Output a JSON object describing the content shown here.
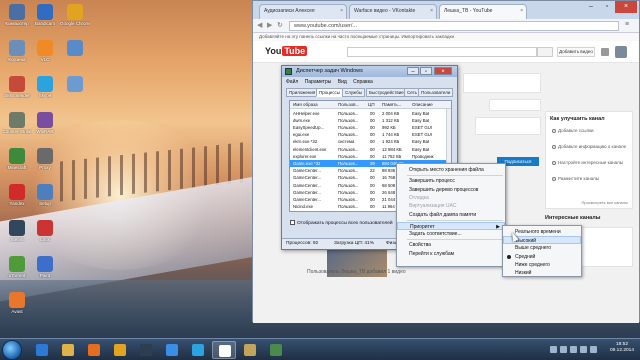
{
  "desktop": {
    "icons_left": [
      {
        "label": "Компьютер",
        "color": "#4a6fa5"
      },
      {
        "label": "Корзина",
        "color": "#6b8fb8"
      },
      {
        "label": "SMS Sender",
        "color": "#c64a3a"
      },
      {
        "label": "Counter-Strike",
        "color": "#6e7a6a"
      },
      {
        "label": "Minecraft",
        "color": "#3d8a3d"
      },
      {
        "label": "Yandex",
        "color": "#d12a2a"
      },
      {
        "label": "Steam",
        "color": "#33475c"
      },
      {
        "label": "uTorrent",
        "color": "#4f9b3a"
      },
      {
        "label": "Avast",
        "color": "#e8762b"
      }
    ],
    "icons_col2": [
      {
        "label": "Bandicam",
        "color": "#2f6cc2"
      },
      {
        "label": "VLC",
        "color": "#f08a24"
      },
      {
        "label": "Skype",
        "color": "#2aa3e0"
      },
      {
        "label": "WinRAR",
        "color": "#7a4da0"
      },
      {
        "label": "Proxy",
        "color": "#6a6a6a"
      },
      {
        "label": "Setup",
        "color": "#4d7fbf"
      },
      {
        "label": "Lock",
        "color": "#c33"
      },
      {
        "label": "Paint",
        "color": "#3d6ec9"
      }
    ],
    "icons_col3": [
      {
        "label": "Google Chrome",
        "color": "#e2a321"
      },
      {
        "label": "",
        "color": "#5a8ac8"
      },
      {
        "label": "",
        "color": "#6b9bd1"
      }
    ]
  },
  "chrome": {
    "tabs": [
      {
        "label": "Аудиозаписи Алексея",
        "active": false
      },
      {
        "label": "Warface видео - VKontakte",
        "active": false
      },
      {
        "label": "Лешка_ТВ - YouTube",
        "active": true
      }
    ],
    "url": "www.youtube.com/user/...",
    "infobar": "Добавляйте на эту панель ссылки на часто посещаемые страницы. Импортировать закладки",
    "yt_logo": "You",
    "yt_logo_tube": "Tube",
    "upload_label": "Добавить видео",
    "subscribe_label": "Подписаться",
    "right_panel": {
      "title": "Как улучшить канал",
      "items": [
        "Добавьте ссылки",
        "Добавьте информацию о канале",
        "Настройте интересные каналы",
        "Разместите каналы"
      ],
      "link": "Просмотреть все каналы"
    },
    "interesting_title": "Интересные каналы",
    "uploader": "Пользователь Лешка_ТВ добавил 1 видео"
  },
  "taskmgr": {
    "title": "Диспетчер задач Windows",
    "menu": [
      "Файл",
      "Параметры",
      "Вид",
      "Справка"
    ],
    "tabs": [
      "Приложения",
      "Процессы",
      "Службы",
      "Быстродействие",
      "Сеть",
      "Пользователи"
    ],
    "active_tab": 1,
    "columns": [
      "Имя образа",
      "Пользов...",
      "ЦП",
      "Память...",
      "Описание"
    ],
    "rows": [
      {
        "name": "AHHelper.exe",
        "user": "Пользов...",
        "cpu": "00",
        "mem": "2 004 КБ",
        "desc": "Easy Bat"
      },
      {
        "name": "dwm.exe",
        "user": "Пользов...",
        "cpu": "00",
        "mem": "1 312 КБ",
        "desc": "Easy Bat"
      },
      {
        "name": "EasySpeedUp...",
        "user": "Пользов...",
        "cpu": "00",
        "mem": "992 КБ",
        "desc": "ESET GUI"
      },
      {
        "name": "egui.exe",
        "user": "Пользов...",
        "cpu": "00",
        "mem": "1 744 КБ",
        "desc": "ESET GUI"
      },
      {
        "name": "ekrn.exe *32",
        "user": "система",
        "cpu": "00",
        "mem": "1 924 КБ",
        "desc": "Easy Bat"
      },
      {
        "name": "elementclient.exe",
        "user": "Пользов...",
        "cpu": "00",
        "mem": "12 984 КБ",
        "desc": "Easy Bat"
      },
      {
        "name": "explorer.exe",
        "user": "Пользов...",
        "cpu": "00",
        "mem": "11 752 КБ",
        "desc": "Проводник"
      },
      {
        "name": "Game.exe *32",
        "user": "Пользов...",
        "cpu": "29",
        "mem": "684 048 КБ",
        "desc": ""
      },
      {
        "name": "GameCenter...",
        "user": "Пользов...",
        "cpu": "22",
        "mem": "88 936 КБ",
        "desc": ""
      },
      {
        "name": "GameCenter...",
        "user": "Пользов...",
        "cpu": "00",
        "mem": "16 768 КБ",
        "desc": ""
      },
      {
        "name": "GameCenter...",
        "user": "Пользов...",
        "cpu": "00",
        "mem": "68 508 КБ",
        "desc": ""
      },
      {
        "name": "GameCenter...",
        "user": "Пользов...",
        "cpu": "00",
        "mem": "26 648 КБ",
        "desc": ""
      },
      {
        "name": "GameCenter...",
        "user": "Пользов...",
        "cpu": "00",
        "mem": "21 044 КБ",
        "desc": ""
      },
      {
        "name": "Nicind.exe",
        "user": "Пользов...",
        "cpu": "00",
        "mem": "11 964 КБ",
        "desc": ""
      }
    ],
    "selected_row": 7,
    "all_users_label": "Отображать процессы всех пользователей",
    "end_process_label": "Завершить процесс",
    "status": {
      "processes": "Процессов: 92",
      "cpu": "Загрузка ЦП: 41%",
      "memory": "Физическая память: 78%"
    }
  },
  "context_menu": {
    "items": [
      {
        "label": "Открыть место хранения файла",
        "disabled": false
      },
      {
        "sep": true
      },
      {
        "label": "Завершить процесс",
        "disabled": false
      },
      {
        "label": "Завершить дерево процессов",
        "disabled": false
      },
      {
        "label": "Отладка",
        "disabled": true
      },
      {
        "label": "Виртуализация UAC",
        "disabled": true
      },
      {
        "label": "Создать файл дампа памяти",
        "disabled": false
      },
      {
        "sep": true
      },
      {
        "label": "Приоритет",
        "disabled": false,
        "submenu": true
      },
      {
        "label": "Задать соответствие...",
        "disabled": false
      },
      {
        "sep": true
      },
      {
        "label": "Свойства",
        "disabled": false
      },
      {
        "label": "Перейти к службам",
        "disabled": false
      }
    ]
  },
  "priority_menu": {
    "items": [
      {
        "label": "Реального времени"
      },
      {
        "label": "Высокий"
      },
      {
        "label": "Выше среднего"
      },
      {
        "label": "Средний",
        "checked": true
      },
      {
        "label": "Ниже среднего"
      },
      {
        "label": "Низкий"
      }
    ],
    "hover_index": 1
  },
  "taskbar": {
    "apps": [
      {
        "name": "ie",
        "color": "#2a7ad6"
      },
      {
        "name": "explorer",
        "color": "#e0b24a"
      },
      {
        "name": "media",
        "color": "#e46d1f"
      },
      {
        "name": "chrome",
        "color": "#e2a321"
      },
      {
        "name": "steam",
        "color": "#2c3e50"
      },
      {
        "name": "mail",
        "color": "#3a8ee6"
      },
      {
        "name": "skype",
        "color": "#2aa3e0"
      },
      {
        "name": "warface",
        "color": "#ffffff"
      },
      {
        "name": "game",
        "color": "#c2a45b"
      },
      {
        "name": "taskmgr",
        "color": "#4a8a4a"
      }
    ],
    "active_index": 7,
    "clock_time": "18:52",
    "clock_date": "09.12.2014"
  }
}
